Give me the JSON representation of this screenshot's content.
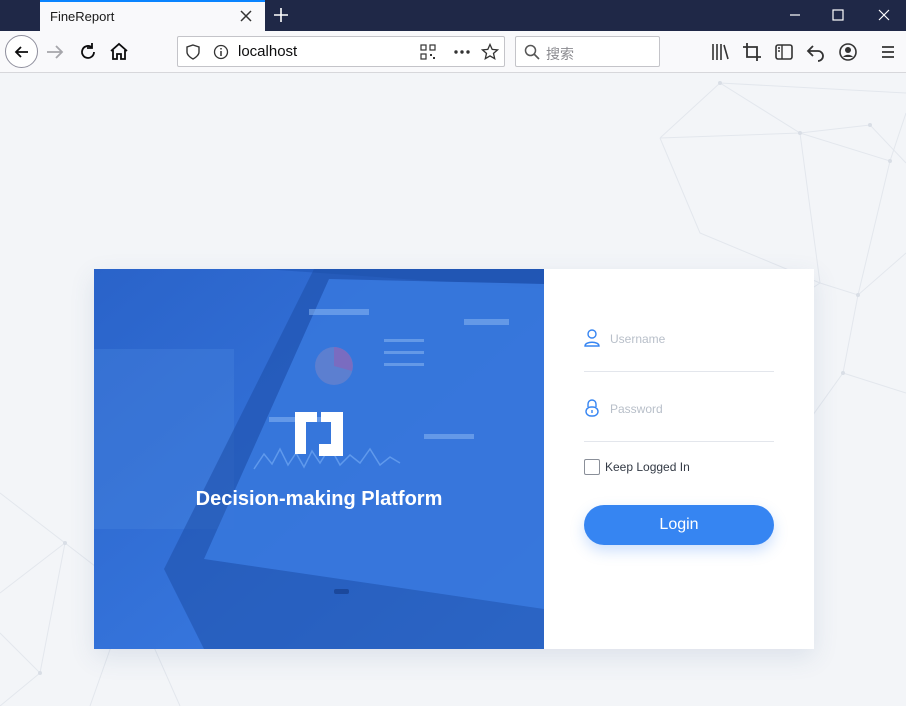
{
  "browser": {
    "tab_title": "FineReport",
    "url": "localhost",
    "search_placeholder": "搜索"
  },
  "login": {
    "platform_title": "Decision-making Platform",
    "username_placeholder": "Username",
    "password_placeholder": "Password",
    "keep_logged_in_label": "Keep Logged In",
    "login_button": "Login"
  },
  "colors": {
    "titlebar": "#1f2847",
    "accent": "#3685f2",
    "hero_blue": "#2f6fd8"
  }
}
